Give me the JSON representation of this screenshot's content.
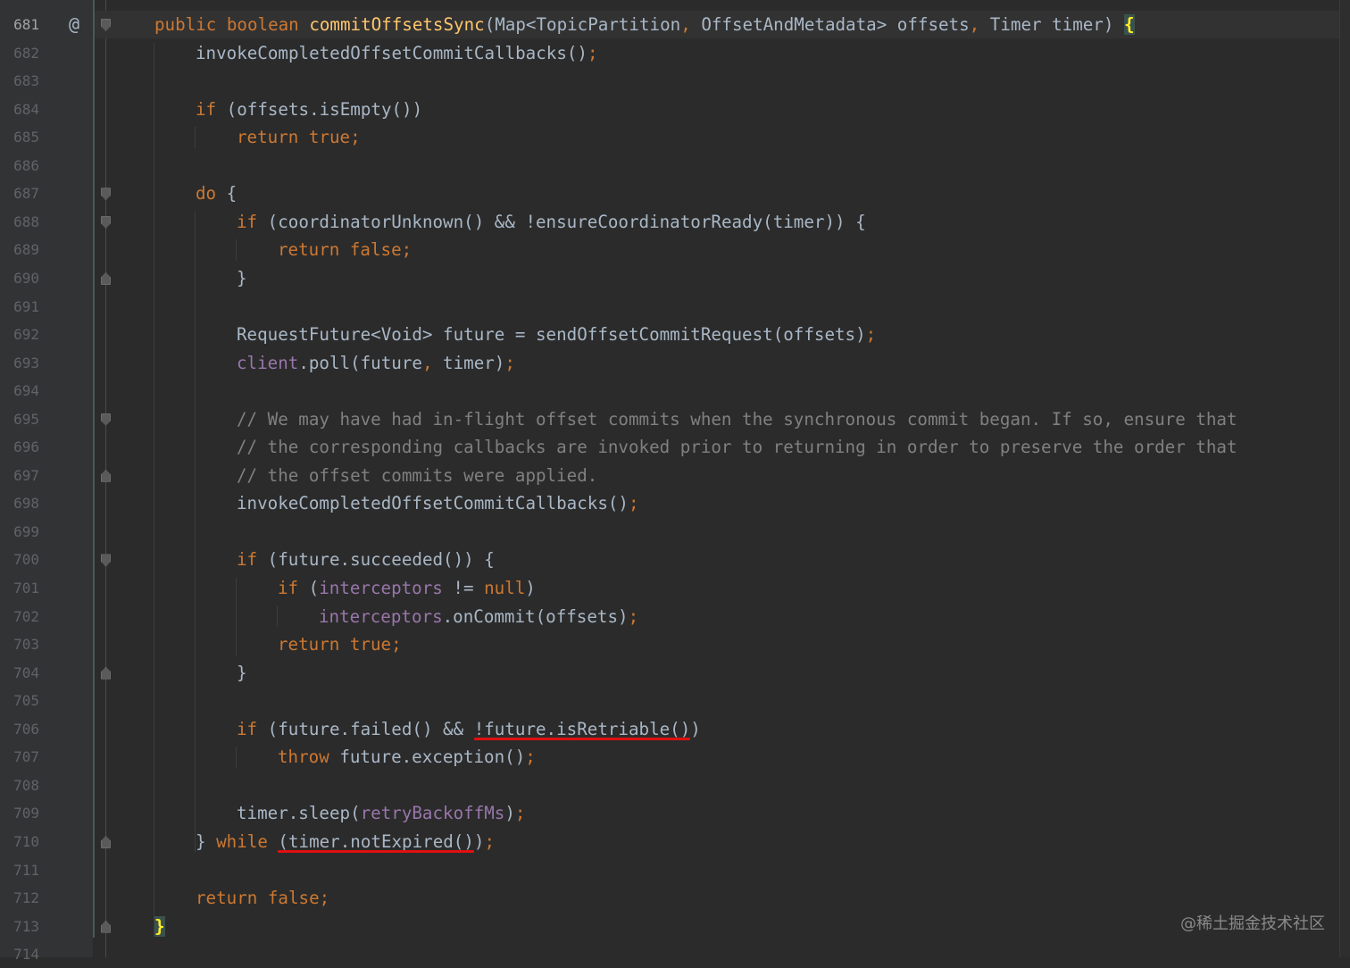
{
  "editor": {
    "colors": {
      "background": "#2b2b2b",
      "keyword": "#cc7832",
      "method_decl": "#ffc66d",
      "field": "#9876aa",
      "comment": "#808080",
      "default": "#a9b7c6",
      "highlight_underline": "#e01010"
    },
    "gutter_icon": "@",
    "lines": [
      {
        "num": "681",
        "indent": 0,
        "fold": "start",
        "tokens": [
          [
            "kw",
            "public"
          ],
          [
            "t",
            " "
          ],
          [
            "kw",
            "boolean"
          ],
          [
            "t",
            " "
          ],
          [
            "fn",
            "commitOffsetsSync"
          ],
          [
            "t",
            "(Map<TopicPartition"
          ],
          [
            "kw",
            ","
          ],
          [
            "t",
            " OffsetAndMetadata> offsets"
          ],
          [
            "kw",
            ","
          ],
          [
            "t",
            " Timer timer) "
          ],
          [
            "brace",
            "{"
          ]
        ]
      },
      {
        "num": "682",
        "indent": 1,
        "tokens": [
          [
            "t",
            "invokeCompletedOffsetCommitCallbacks()"
          ],
          [
            "kw",
            ";"
          ]
        ]
      },
      {
        "num": "683",
        "indent": 0,
        "tokens": []
      },
      {
        "num": "684",
        "indent": 1,
        "tokens": [
          [
            "kw",
            "if"
          ],
          [
            "t",
            " (offsets.isEmpty())"
          ]
        ]
      },
      {
        "num": "685",
        "indent": 2,
        "tokens": [
          [
            "kw",
            "return"
          ],
          [
            "t",
            " "
          ],
          [
            "kw",
            "true;"
          ]
        ]
      },
      {
        "num": "686",
        "indent": 0,
        "tokens": []
      },
      {
        "num": "687",
        "indent": 1,
        "fold": "start",
        "tokens": [
          [
            "kw",
            "do"
          ],
          [
            "t",
            " {"
          ]
        ]
      },
      {
        "num": "688",
        "indent": 2,
        "fold": "start",
        "tokens": [
          [
            "kw",
            "if"
          ],
          [
            "t",
            " (coordinatorUnknown() && !ensureCoordinatorReady(timer)) {"
          ]
        ]
      },
      {
        "num": "689",
        "indent": 3,
        "tokens": [
          [
            "kw",
            "return"
          ],
          [
            "t",
            " "
          ],
          [
            "kw",
            "false;"
          ]
        ]
      },
      {
        "num": "690",
        "indent": 2,
        "fold": "end",
        "tokens": [
          [
            "t",
            "}"
          ]
        ]
      },
      {
        "num": "691",
        "indent": 0,
        "tokens": []
      },
      {
        "num": "692",
        "indent": 2,
        "tokens": [
          [
            "t",
            "RequestFuture<Void> future = sendOffsetCommitRequest(offsets)"
          ],
          [
            "kw",
            ";"
          ]
        ]
      },
      {
        "num": "693",
        "indent": 2,
        "tokens": [
          [
            "fld",
            "client"
          ],
          [
            "t",
            ".poll(future"
          ],
          [
            "kw",
            ","
          ],
          [
            "t",
            " timer)"
          ],
          [
            "kw",
            ";"
          ]
        ]
      },
      {
        "num": "694",
        "indent": 0,
        "tokens": []
      },
      {
        "num": "695",
        "indent": 2,
        "fold": "start",
        "tokens": [
          [
            "cm",
            "// We may have had in-flight offset commits when the synchronous commit began. If so, ensure that"
          ]
        ]
      },
      {
        "num": "696",
        "indent": 2,
        "tokens": [
          [
            "cm",
            "// the corresponding callbacks are invoked prior to returning in order to preserve the order that"
          ]
        ]
      },
      {
        "num": "697",
        "indent": 2,
        "fold": "end",
        "tokens": [
          [
            "cm",
            "// the offset commits were applied."
          ]
        ]
      },
      {
        "num": "698",
        "indent": 2,
        "tokens": [
          [
            "t",
            "invokeCompletedOffsetCommitCallbacks()"
          ],
          [
            "kw",
            ";"
          ]
        ]
      },
      {
        "num": "699",
        "indent": 0,
        "tokens": []
      },
      {
        "num": "700",
        "indent": 2,
        "fold": "start",
        "tokens": [
          [
            "kw",
            "if"
          ],
          [
            "t",
            " (future.succeeded()) {"
          ]
        ]
      },
      {
        "num": "701",
        "indent": 3,
        "tokens": [
          [
            "kw",
            "if"
          ],
          [
            "t",
            " ("
          ],
          [
            "fld",
            "interceptors"
          ],
          [
            "t",
            " != "
          ],
          [
            "kw",
            "null"
          ],
          [
            "t",
            ")"
          ]
        ]
      },
      {
        "num": "702",
        "indent": 4,
        "tokens": [
          [
            "fld",
            "interceptors"
          ],
          [
            "t",
            ".onCommit(offsets)"
          ],
          [
            "kw",
            ";"
          ]
        ]
      },
      {
        "num": "703",
        "indent": 3,
        "tokens": [
          [
            "kw",
            "return"
          ],
          [
            "t",
            " "
          ],
          [
            "kw",
            "true;"
          ]
        ]
      },
      {
        "num": "704",
        "indent": 2,
        "fold": "end",
        "tokens": [
          [
            "t",
            "}"
          ]
        ]
      },
      {
        "num": "705",
        "indent": 0,
        "tokens": []
      },
      {
        "num": "706",
        "indent": 2,
        "tokens": [
          [
            "kw",
            "if"
          ],
          [
            "t",
            " (future.failed() && !future.isRetriable())"
          ]
        ]
      },
      {
        "num": "707",
        "indent": 3,
        "tokens": [
          [
            "kw",
            "throw"
          ],
          [
            "t",
            " future.exception()"
          ],
          [
            "kw",
            ";"
          ]
        ]
      },
      {
        "num": "708",
        "indent": 0,
        "tokens": []
      },
      {
        "num": "709",
        "indent": 2,
        "tokens": [
          [
            "t",
            "timer.sleep("
          ],
          [
            "fld",
            "retryBackoffMs"
          ],
          [
            "t",
            ")"
          ],
          [
            "kw",
            ";"
          ]
        ]
      },
      {
        "num": "710",
        "indent": 1,
        "fold": "end",
        "tokens": [
          [
            "t",
            "} "
          ],
          [
            "kw",
            "while"
          ],
          [
            "t",
            " (timer.notExpired())"
          ],
          [
            "kw",
            ";"
          ]
        ]
      },
      {
        "num": "711",
        "indent": 0,
        "tokens": []
      },
      {
        "num": "712",
        "indent": 1,
        "tokens": [
          [
            "kw",
            "return"
          ],
          [
            "t",
            " "
          ],
          [
            "kw",
            "false;"
          ]
        ]
      },
      {
        "num": "713",
        "indent": 0,
        "fold": "end",
        "tokens": [
          [
            "brace",
            "}"
          ]
        ]
      },
      {
        "num": "714",
        "indent": 0,
        "tokens": []
      }
    ],
    "highlights": [
      {
        "line_index": 25,
        "text": "!future.isRetriable()"
      },
      {
        "line_index": 29,
        "text": "(timer.notExpired()"
      }
    ]
  },
  "watermark": "@稀土掘金技术社区"
}
